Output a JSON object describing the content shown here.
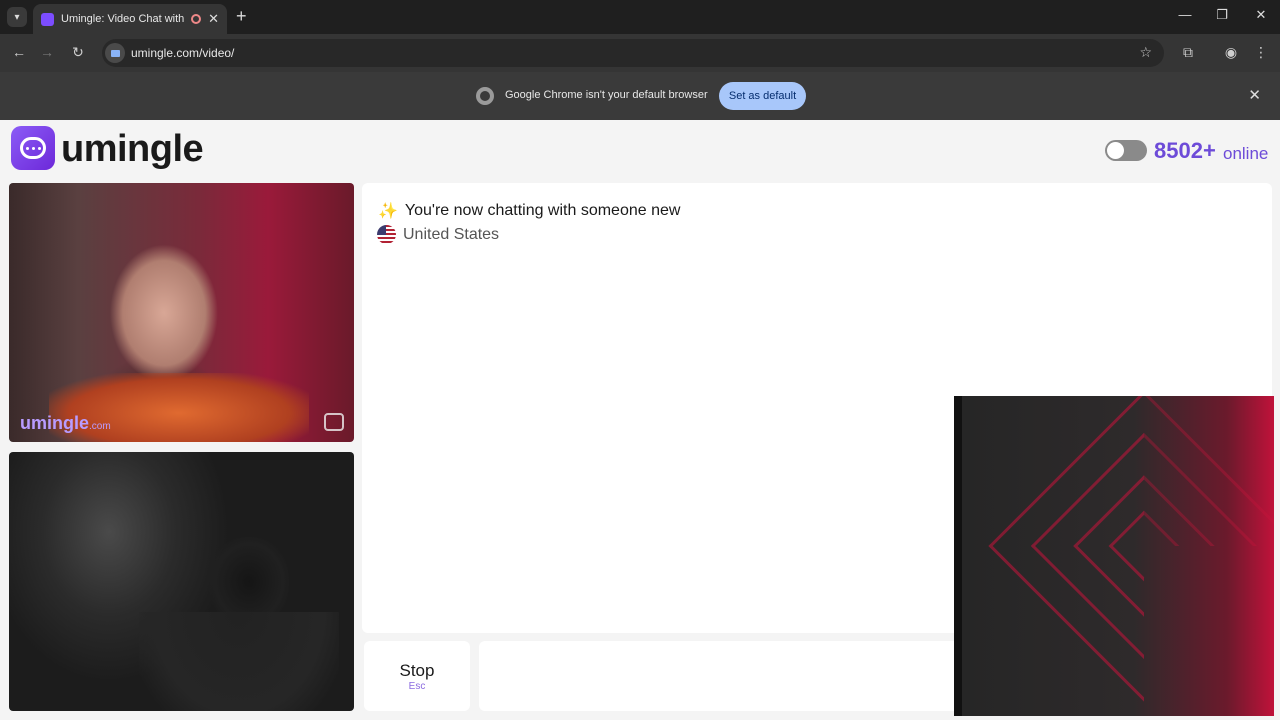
{
  "browser": {
    "tab_title": "Umingle: Video Chat with St",
    "url": "umingle.com/video/",
    "infobar_text": "Google Chrome isn't your default browser",
    "infobar_button": "Set as default"
  },
  "header": {
    "logo_text": "umingle",
    "online_count": "8502+",
    "online_label": "online"
  },
  "video": {
    "watermark": "umingle",
    "watermark_suffix": ".com"
  },
  "chat": {
    "status_message": "You're now chatting with someone new",
    "country": "United States"
  },
  "controls": {
    "stop_label": "Stop",
    "stop_shortcut": "Esc",
    "message_placeholder": ""
  },
  "colors": {
    "brand": "#6d4bd8",
    "infobar_button": "#a8c7fa"
  }
}
